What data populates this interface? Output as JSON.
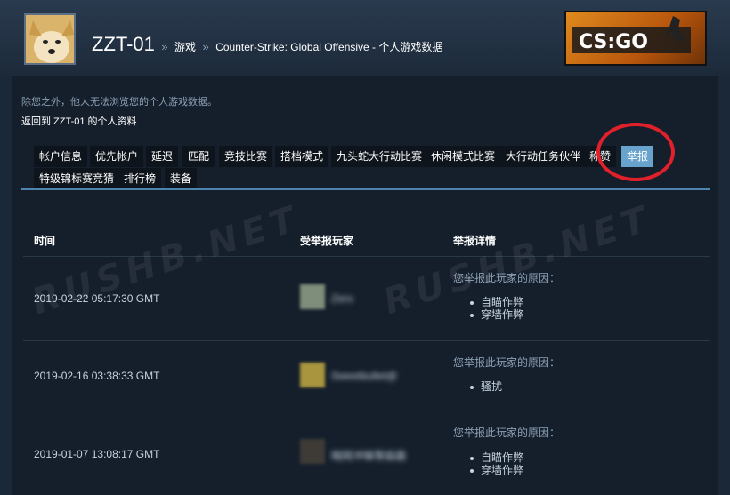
{
  "header": {
    "username": "ZZT-01",
    "separator": "»",
    "crumb_games": "游戏",
    "crumb_title": "Counter-Strike: Global Offensive - 个人游戏数据",
    "logo_text": "CS:GO"
  },
  "note": "除您之外，他人无法浏览您的个人游戏数据。",
  "back_link": "返回到 ZZT-01 的个人资料",
  "tabs": [
    "帐户信息",
    "优先帐户",
    "延迟",
    "匹配",
    "竞技比赛",
    "搭档模式",
    "九头蛇大行动比赛",
    "休闲模式比赛",
    "大行动任务伙伴",
    "称赞",
    "举报",
    "特级锦标赛竞猜",
    "排行榜",
    "装备"
  ],
  "active_tab": "举报",
  "table": {
    "headers": [
      "时间",
      "受举报玩家",
      "举报详情"
    ],
    "rows": [
      {
        "time": "2019-02-22 05:17:30 GMT",
        "player": "Zero",
        "reason_label": "您举报此玩家的原因：",
        "reasons": [
          "自瞄作弊",
          "穿墙作弊"
        ]
      },
      {
        "time": "2019-02-16 03:38:33 GMT",
        "player": "Sweetbullet@",
        "reason_label": "您举报此玩家的原因：",
        "reasons": [
          "骚扰"
        ]
      },
      {
        "time": "2019-01-07 13:08:17 GMT",
        "player": "暗网冲锋等级器",
        "reason_label": "您举报此玩家的原因：",
        "reasons": [
          "自瞄作弊",
          "穿墙作弊"
        ]
      }
    ]
  },
  "watermark": "RUSHB.NET",
  "colors": {
    "accent": "#67a3cc",
    "highlight_circle": "#e0202a",
    "background": "#1b2838"
  }
}
